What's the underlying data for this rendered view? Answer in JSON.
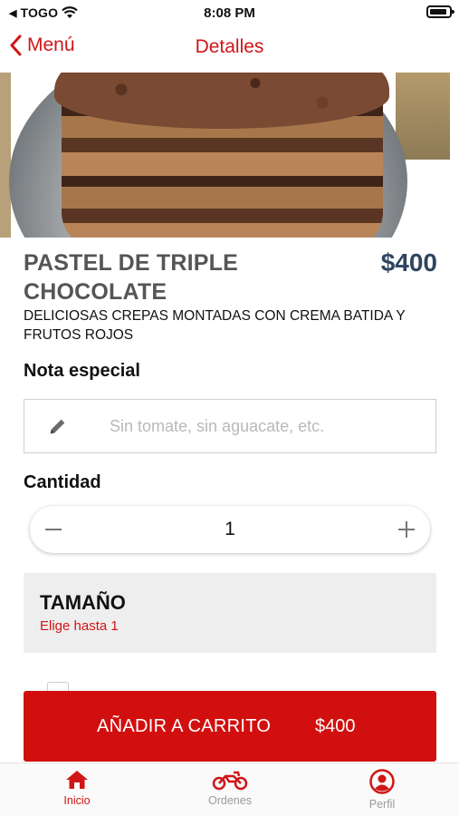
{
  "status_bar": {
    "carrier": "TOGO",
    "time": "8:08 PM"
  },
  "nav": {
    "back_label": "Menú",
    "title": "Detalles"
  },
  "product": {
    "title": "PASTEL DE TRIPLE CHOCOLATE",
    "price": "$400",
    "description": "DELICIOSAS CREPAS MONTADAS CON CREMA BATIDA Y FRUTOS ROJOS"
  },
  "note": {
    "label": "Nota especial",
    "placeholder": "Sin tomate, sin aguacate, etc.",
    "value": ""
  },
  "quantity": {
    "label": "Cantidad",
    "value": "1"
  },
  "size": {
    "title": "TAMAÑO",
    "subtitle": "Elige hasta 1"
  },
  "add_to_cart": {
    "label": "AÑADIR A CARRITO",
    "price": "$400"
  },
  "tabs": [
    {
      "label": "Inicio",
      "icon": "home-icon",
      "active": true
    },
    {
      "label": "Ordenes",
      "icon": "motorcycle-icon",
      "active": false
    },
    {
      "label": "Perfil",
      "icon": "user-icon",
      "active": false
    }
  ],
  "colors": {
    "accent": "#d01616",
    "price": "#2f4560",
    "inactive_tab": "#9a9a9a"
  }
}
